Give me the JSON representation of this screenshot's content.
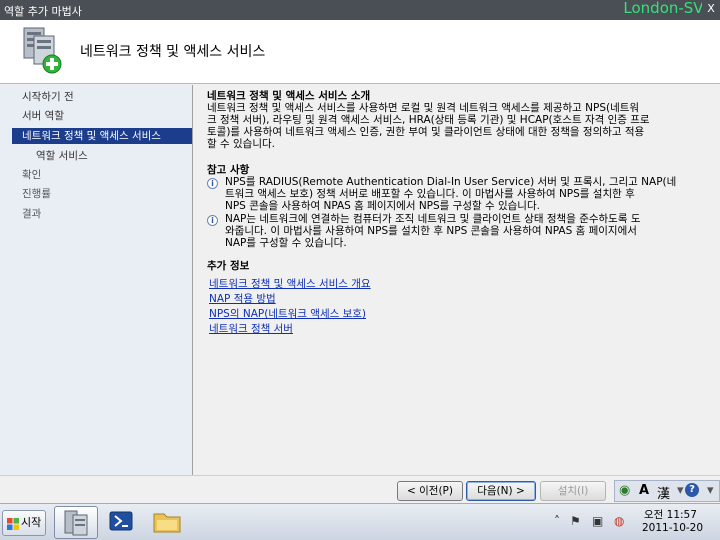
{
  "window": {
    "title": "역할 추가 마법사",
    "hostname": "London-SVR",
    "close_glyph": "X",
    "header_title": "네트워크 정책 및 액세스 서비스"
  },
  "sidebar": {
    "items": [
      {
        "label": "시작하기 전",
        "state": "normal"
      },
      {
        "label": "서버 역할",
        "state": "normal"
      },
      {
        "label": "네트워크 정책 및 액세스 서비스",
        "state": "active"
      },
      {
        "label": "역할 서비스",
        "state": "sub"
      },
      {
        "label": "확인",
        "state": "muted"
      },
      {
        "label": "진행률",
        "state": "muted"
      },
      {
        "label": "결과",
        "state": "muted"
      }
    ]
  },
  "content": {
    "intro_heading": "네트워크 정책 및 액세스 서비스 소개",
    "intro_lines": [
      "네트워크 정책 및 액세스 서비스를 사용하면 로컬 및 원격 네트워크 액세스를 제공하고 NPS(네트워",
      "크 정책 서버), 라우팅 및 원격 액세스 서비스, HRA(상태 등록 기관) 및 HCAP(호스트 자격 인증 프로",
      "토콜)를 사용하여 네트워크 액세스 인증, 권한 부여 및 클라이언트 상태에 대한 정책을 정의하고 적용",
      "할 수 있습니다."
    ],
    "notes_heading": "참고 사항",
    "notes": [
      {
        "icon": "info-icon",
        "lines": [
          "NPS를 RADIUS(Remote Authentication Dial-In User Service) 서버 및 프록시, 그리고 NAP(네",
          "트워크 액세스 보호) 정책 서버로 배포할 수 있습니다. 이 마법사를 사용하여 NPS를 설치한 후",
          "NPS 콘솔을 사용하여 NPAS 홈 페이지에서 NPS를 구성할 수 있습니다."
        ]
      },
      {
        "icon": "info-icon",
        "lines": [
          "NAP는 네트워크에 연결하는 컴퓨터가 조직 네트워크 및 클라이언트 상태 정책을 준수하도록 도",
          "와줍니다. 이 마법사를 사용하여 NPS를 설치한 후 NPS 콘솔을 사용하여 NPAS 홈 페이지에서",
          "NAP를 구성할 수 있습니다."
        ]
      }
    ],
    "more_heading": "추가 정보",
    "links": [
      "네트워크 정책 및 액세스 서비스 개요",
      "NAP 적용 방법",
      "NPS의 NAP(네트워크 액세스 보호)",
      "네트워크 정책 서버"
    ]
  },
  "buttons": {
    "back": "< 이전(P)",
    "next": "다음(N) >",
    "install": "설치(I)"
  },
  "langbar": {
    "ime_a": "A",
    "ime_han": "漢",
    "help": "?"
  },
  "taskbar": {
    "start_label": "시작",
    "time": "오전 11:57",
    "date": "2011-10-20"
  }
}
